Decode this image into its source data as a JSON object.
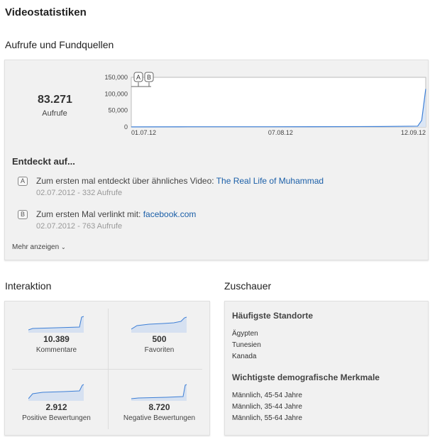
{
  "page": {
    "title": "Videostatistiken",
    "views_section_title": "Aufrufe und Fundquellen",
    "interaction_section_title": "Interaktion",
    "audience_section_title": "Zuschauer"
  },
  "views": {
    "total": "83.271",
    "total_label": "Aufrufe"
  },
  "chart_data": {
    "type": "line",
    "x_tick_labels": [
      "01.07.12",
      "07.08.12",
      "12.09.12"
    ],
    "y_tick_labels": [
      "150,000",
      "100,000",
      "50,000",
      "0"
    ],
    "ylim": [
      0,
      150000
    ],
    "x": [
      "01.07.12",
      "15.07.12",
      "01.08.12",
      "15.08.12",
      "01.09.12",
      "10.09.12",
      "11.09.12",
      "12.09.12"
    ],
    "values": [
      300,
      600,
      700,
      900,
      1200,
      2500,
      20000,
      115000
    ],
    "markers": [
      {
        "letter": "A",
        "x": "02.07.12"
      },
      {
        "letter": "B",
        "x": "02.07.12"
      }
    ],
    "line_color": "#3d7fd6",
    "area_color": "#dbe6f5",
    "grid": false
  },
  "discovery": {
    "title": "Entdeckt auf...",
    "items": [
      {
        "marker": "A",
        "text": "Zum ersten mal entdeckt über ähnliches Video: ",
        "link": "The Real Life of Muhammad",
        "meta": "02.07.2012 - 332 Aufrufe"
      },
      {
        "marker": "B",
        "text": "Zum ersten Mal verlinkt mit: ",
        "link": "facebook.com",
        "meta": "02.07.2012 - 763 Aufrufe"
      }
    ],
    "more_label": "Mehr anzeigen",
    "more_icon": "chevron-down-icon"
  },
  "interaction": {
    "metrics": [
      {
        "value": "10.389",
        "label": "Kommentare"
      },
      {
        "value": "500",
        "label": "Favoriten"
      },
      {
        "value": "2.912",
        "label": "Positive Bewertungen"
      },
      {
        "value": "8.720",
        "label": "Negative Bewertungen"
      }
    ],
    "sparkline_color": "#3d7fd6"
  },
  "audience": {
    "locations_title": "Häufigste Standorte",
    "locations": [
      "Ägypten",
      "Tunesien",
      "Kanada"
    ],
    "demographics_title": "Wichtigste demografische Merkmale",
    "demographics": [
      "Männlich, 45-54 Jahre",
      "Männlich, 35-44 Jahre",
      "Männlich, 55-64 Jahre"
    ]
  }
}
